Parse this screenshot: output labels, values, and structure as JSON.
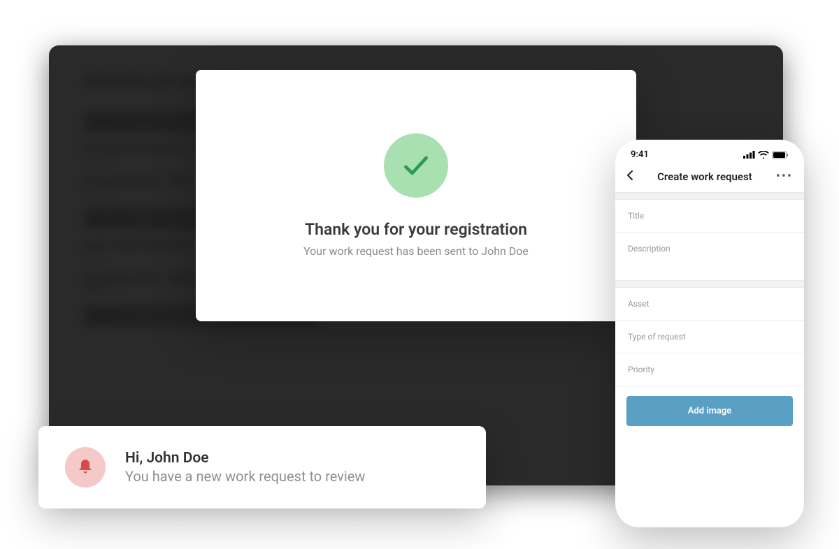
{
  "confirmation": {
    "title": "Thank you for your registration",
    "subtitle": "Your work request has been sent to John Doe"
  },
  "phone": {
    "status_time": "9:41",
    "header_title": "Create work request",
    "fields": {
      "title": "Title",
      "description": "Description",
      "asset": "Asset",
      "type_of_request": "Type of request",
      "priority": "Priority"
    },
    "add_image_label": "Add image"
  },
  "notification": {
    "greeting": "Hi, John Doe",
    "body": "You have a new work request to review"
  }
}
